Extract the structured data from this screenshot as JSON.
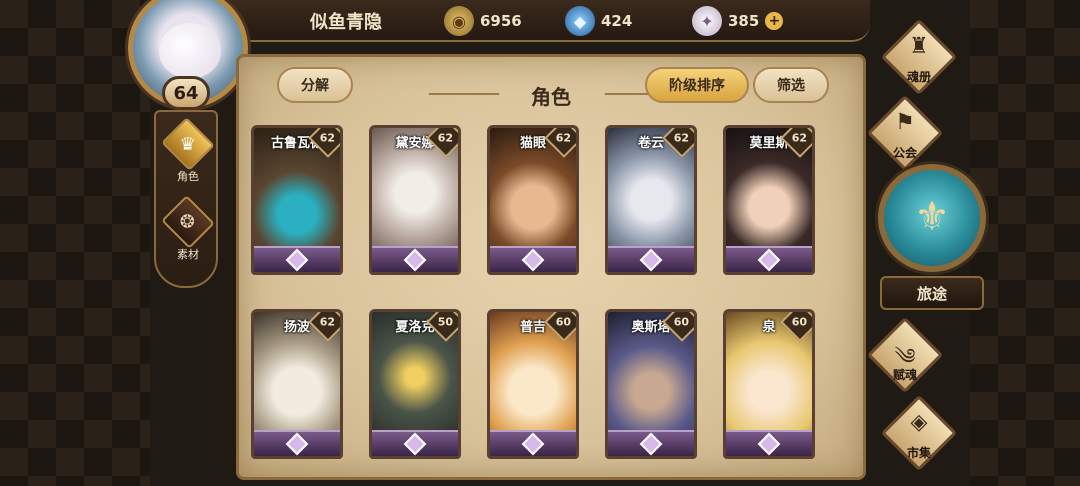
{
  "player": {
    "name": "似鱼青隐",
    "level": "64"
  },
  "resources": {
    "gold": "6956",
    "crystal": "424",
    "gem": "385",
    "gem_plus": "+"
  },
  "left_nav": {
    "role_label": "角色",
    "material_label": "素材"
  },
  "panel": {
    "title": "角色",
    "split_button": "分解",
    "sort_button": "阶级排序",
    "filter_button": "筛选"
  },
  "characters": [
    {
      "name": "古鲁瓦德",
      "level": "62"
    },
    {
      "name": "黛安娜",
      "level": "62"
    },
    {
      "name": "猫眼",
      "level": "62"
    },
    {
      "name": "卷云",
      "level": "62"
    },
    {
      "name": "莫里斯",
      "level": "62"
    },
    {
      "name": "扬波",
      "level": "62"
    },
    {
      "name": "夏洛克",
      "level": "50"
    },
    {
      "name": "普吉",
      "level": "60"
    },
    {
      "name": "奥斯塔",
      "level": "60"
    },
    {
      "name": "泉",
      "level": "60"
    }
  ],
  "right_menu": {
    "book": "魂册",
    "guild": "公会",
    "journey": "旅途",
    "talent": "赋魂",
    "market": "市集"
  },
  "colors": {
    "parchment": "#d8c29a",
    "frame": "#8a6a3a",
    "accent_gold": "#e9b64a",
    "rank_purple": "#7a5a8a"
  }
}
